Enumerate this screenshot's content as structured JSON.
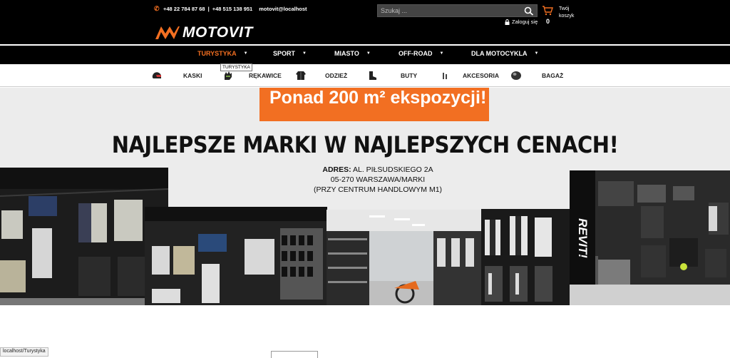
{
  "header": {
    "phone1": "+48 22 784 87 68",
    "separator": "|",
    "phone2": "+48 515 138 951",
    "email": "motovit@localhost",
    "logo_text": "MOTOVIT",
    "search_placeholder": "Szukaj ...",
    "login_label": "Zaloguj się",
    "cart_label": "Twój koszyk",
    "cart_count": "0",
    "accent_color": "#f36f21"
  },
  "main_nav": {
    "items": [
      {
        "label": "TURYSTYKA",
        "active": true
      },
      {
        "label": "SPORT"
      },
      {
        "label": "MIASTO"
      },
      {
        "label": "OFF-ROAD"
      },
      {
        "label": "DLA MOTOCYKLA"
      }
    ],
    "tooltip": "TURYSTYKA"
  },
  "categories": [
    {
      "label": "KASKI",
      "icon": "helmet-icon"
    },
    {
      "label": "RĘKAWICE",
      "icon": "glove-icon"
    },
    {
      "label": "ODZIEŻ",
      "icon": "jacket-icon"
    },
    {
      "label": "BUTY",
      "icon": "boot-icon"
    },
    {
      "label": "AKCESORIA",
      "icon": "accessory-icon"
    },
    {
      "label": "BAGAŻ",
      "icon": "bag-icon"
    }
  ],
  "banner": {
    "exposition_text": "Ponad 200 m² ekspozycji!",
    "headline": "NAJLEPSZE MARKI W NAJLEPSZYCH CENACH!",
    "address_label": "ADRES:",
    "address_line1": "AL. PIŁSUDSKIEGO 2A",
    "address_line2": "05-270 WARSZAWA/MARKI",
    "address_line3": "(PRZY CENTRUM HANDLOWYM M1)",
    "brand_sign": "REVIT!"
  },
  "status_url": "localhost/Turystyka"
}
